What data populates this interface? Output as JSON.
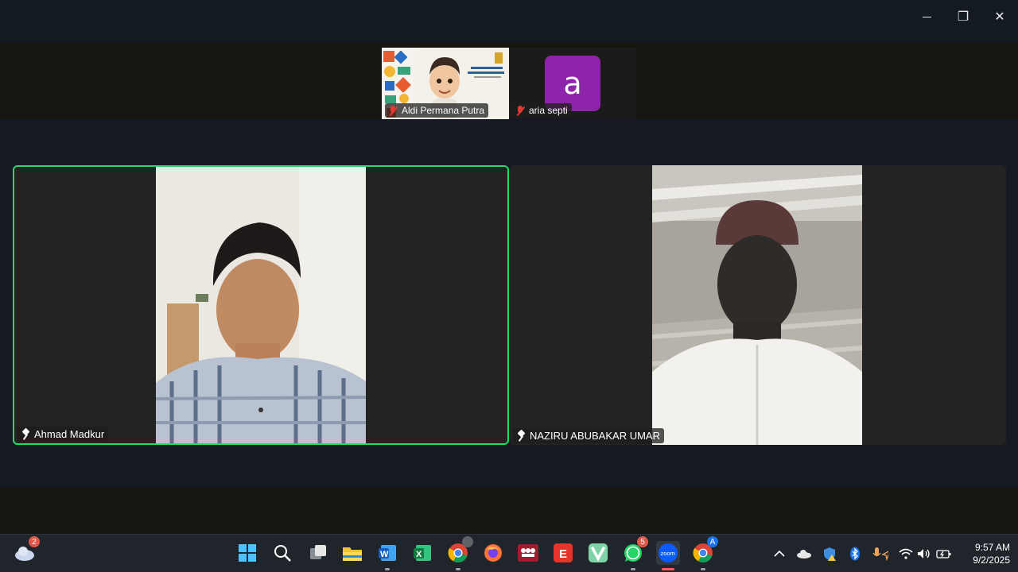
{
  "window": {
    "minimize_glyph": "",
    "restore_glyph": "❐",
    "close_glyph": "✕"
  },
  "thumbnails": [
    {
      "name": "Aldi Permana Putra",
      "muted": true
    },
    {
      "name": "aria septi",
      "avatar_letter": "a",
      "avatar_color": "#8e24aa",
      "muted": true
    }
  ],
  "tiles": [
    {
      "name": "Ahmad Madkur",
      "pinned": true,
      "active_speaker": true
    },
    {
      "name": "NAZIRU ABUBAKAR UMAR",
      "pinned": true,
      "active_speaker": false
    }
  ],
  "colors": {
    "active_speaker_border": "#23d96a",
    "muted_mic": "#e53935",
    "taskbar_bg": "#20252b"
  },
  "taskbar": {
    "weather_badge": "2",
    "whatsapp_badge": "5",
    "chrome_profile_letter": "A",
    "zoom_label": "zoom",
    "excel_letter": "X",
    "word_letter": "W",
    "e_letter": "E",
    "clock": {
      "time": "9:57 AM",
      "date": "9/2/2025"
    }
  }
}
